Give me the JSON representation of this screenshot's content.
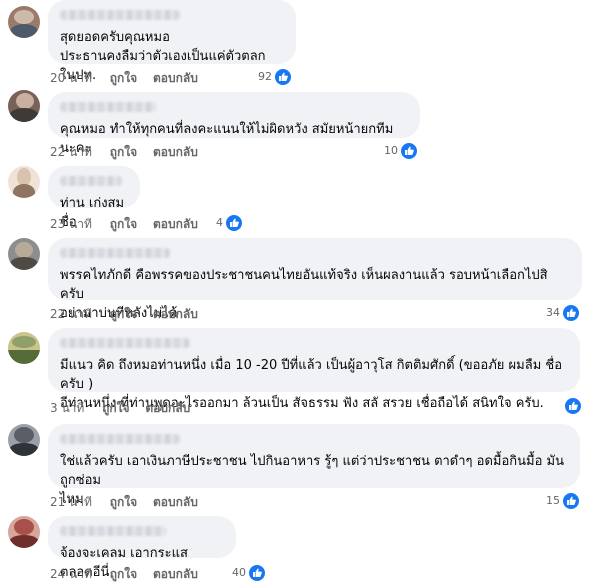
{
  "comments": [
    {
      "text": "สุดยอดครับคุณหมอ\nประธานคงลืมว่าตัวเองเป็นแค่ตัวตลกในปท.",
      "time": "20 นาที",
      "like_label": "ถูกใจ",
      "reply_label": "ตอบกลับ",
      "reaction_count": "92",
      "colors": [
        "#9a7b6b",
        "#4d5a6a",
        "#cdb9a8"
      ]
    },
    {
      "text": "คุณหมอ ทำให้ทุกคนที่ลงคะแนนให้ไม่ผิดหวัง สมัยหน้ายกทีมนะคะ",
      "time": "22 นาที",
      "like_label": "ถูกใจ",
      "reply_label": "ตอบกลับ",
      "reaction_count": "10",
      "colors": [
        "#7a6155",
        "#c9b0a0",
        "#3f3a38"
      ]
    },
    {
      "text": "ท่าน เก่งสมชื่อ",
      "time": "23 นาที",
      "like_label": "ถูกใจ",
      "reply_label": "ตอบกลับ",
      "reaction_count": "4",
      "colors": [
        "#d9c2ae",
        "#8e7461",
        "#efe3d6"
      ]
    },
    {
      "text": "พรรคไทภักดี คือพรรคของประชาชนคนไทยอันแท้จริง เห็นผลงานแล้ว รอบหน้าเลือกไปสิครับ\nอย่ามาบ่นทีหลังไม่ได้",
      "time": "22 นาที",
      "like_label": "ถูกใจ",
      "reply_label": "ตอบกลับ",
      "reaction_count": "34",
      "colors": [
        "#8b8d8f",
        "#4f4a44",
        "#b7aa98"
      ]
    },
    {
      "text": "มีแนว คิด ถึงหมอท่านหนึ่ง เมื่อ 10 -20 ปีที่แล้ว เป็นผู้อาวุโส กิตติมศักดิ์ (ขออภัย ผมลืม ชื่อครับ )\nอีท่านหนึ่ง ที่ท่านพูดอะไรออกมา ล้วนเป็น สัจธรรม ฟัง สลั สรวย เชื่อถือได้ สนิทใจ ครับ.",
      "time": "3 นาที",
      "like_label": "ถูกใจ",
      "reply_label": "ตอบกลับ",
      "reaction_count": "",
      "colors": [
        "#8fa06a",
        "#556b3a",
        "#c9c38e"
      ]
    },
    {
      "text": "ใช่แล้วครับ เอาเงินภาษีประชาชน ไปกินอาหาร รู้ๆ แต่ว่าประชาชน ตาดำๆ อดมื้อกินมื้อ มันถูกซ่อม\nไหม",
      "time": "21 นาที",
      "like_label": "ถูกใจ",
      "reply_label": "ตอบกลับ",
      "reaction_count": "15",
      "colors": [
        "#5a5e66",
        "#2f3238",
        "#9aa0a8"
      ]
    },
    {
      "text": "จ้องจะเคลม เอากระแส ตลอดอีนี่",
      "time": "24 นาที",
      "like_label": "ถูกใจ",
      "reply_label": "ตอบกลับ",
      "reaction_count": "40",
      "colors": [
        "#a8504a",
        "#6e2e2c",
        "#d8a59a"
      ]
    }
  ]
}
